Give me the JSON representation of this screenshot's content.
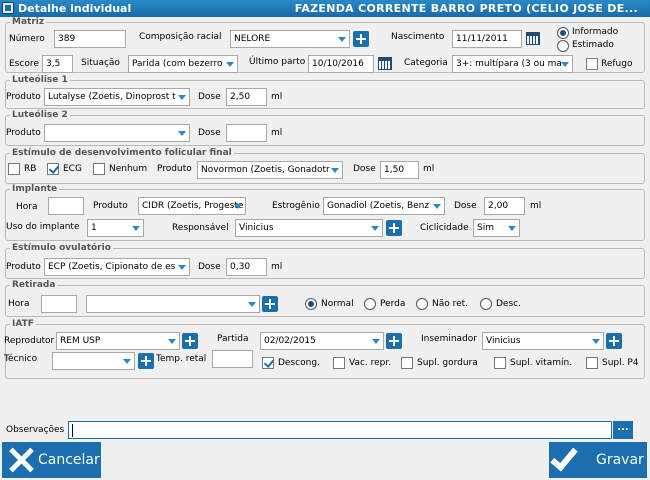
{
  "window": {
    "title": "Detalhe individual",
    "farm": "FAZENDA CORRENTE BARRO PRETO (CELIO JOSE DE..."
  },
  "matriz": {
    "legend": "Matriz",
    "numero_label": "Número",
    "numero": "389",
    "composicao_label": "Composição racial",
    "composicao": "NELORE",
    "nascimento_label": "Nascimento",
    "nascimento": "11/11/2011",
    "informado": "Informado",
    "estimado": "Estimado",
    "escore_label": "Escore",
    "escore": "3,5",
    "situacao_label": "Situação",
    "situacao": "Parida (com bezerro",
    "ultimo_parto_label": "Último parto",
    "ultimo_parto": "10/10/2016",
    "categoria_label": "Categoria",
    "categoria": "3+: multípara (3 ou ma",
    "refugo": "Refugo"
  },
  "luteolise1": {
    "legend": "Luteólise 1",
    "produto_label": "Produto",
    "produto": "Lutalyse (Zoetis, Dinoprost t",
    "dose_label": "Dose",
    "dose": "2,50",
    "unit": "ml"
  },
  "luteolise2": {
    "legend": "Luteólise 2",
    "produto_label": "Produto",
    "produto": "",
    "dose_label": "Dose",
    "dose": "",
    "unit": "ml"
  },
  "estimulo": {
    "legend": "Estímulo de desenvolvimento folicular final",
    "rb": "RB",
    "ecg": "ECG",
    "nenhum": "Nenhum",
    "produto_label": "Produto",
    "produto": "Novormon (Zoetis, Gonadotr",
    "dose_label": "Dose",
    "dose": "1,50",
    "unit": "ml"
  },
  "implante": {
    "legend": "Implante",
    "hora_label": "Hora",
    "hora": "",
    "produto_label": "Produto",
    "produto": "CIDR (Zoetis, Progeste",
    "estrogenio_label": "Estrogênio",
    "estrogenio": "Gonadiol (Zoetis, Benz",
    "dose_label": "Dose",
    "dose": "2,00",
    "unit": "ml",
    "uso_label": "Uso do implante",
    "uso": "1",
    "responsavel_label": "Responsável",
    "responsavel": "Vinicius",
    "ciclicidade_label": "Ciclicidade",
    "ciclicidade": "Sim"
  },
  "ovulatorio": {
    "legend": "Estímulo ovulatório",
    "produto_label": "Produto",
    "produto": "ECP (Zoetis, Cipionato de es",
    "dose_label": "Dose",
    "dose": "0,30",
    "unit": "ml"
  },
  "retirada": {
    "legend": "Retirada",
    "hora_label": "Hora",
    "hora": "",
    "select": "",
    "normal": "Normal",
    "perda": "Perda",
    "nao_ret": "Não ret.",
    "desc": "Desc."
  },
  "iatf": {
    "legend": "IATF",
    "reprodutor_label": "Reprodutor",
    "reprodutor": "REM USP",
    "partida_label": "Partida",
    "partida": "02/02/2015",
    "inseminador_label": "Inseminador",
    "inseminador": "Vinicius",
    "tecnico_label": "Técnico",
    "tecnico": "",
    "temp_retal_label": "Temp. retal",
    "temp_retal": "",
    "descong": "Descong.",
    "vac_repr": "Vac. repr.",
    "supl_gordura": "Supl. gordura",
    "supl_vitamin": "Supl. vitamín.",
    "supl_p4": "Supl. P4"
  },
  "observacoes": {
    "label": "Observações",
    "value": "",
    "more": "..."
  },
  "actions": {
    "cancel": "Cancelar",
    "save": "Gravar"
  },
  "colors": {
    "accent": "#1b6fae",
    "title_bar": "#2a89c8"
  }
}
